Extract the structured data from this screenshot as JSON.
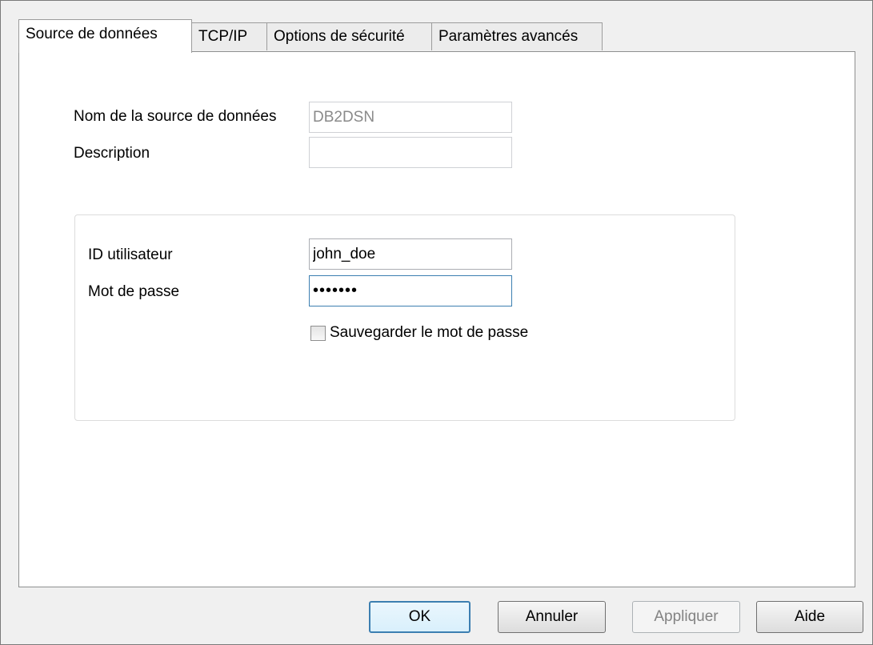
{
  "tabs": [
    {
      "label": "Source de données",
      "active": true
    },
    {
      "label": "TCP/IP",
      "active": false
    },
    {
      "label": "Options de sécurité",
      "active": false
    },
    {
      "label": "Paramètres avancés",
      "active": false
    }
  ],
  "form": {
    "dsn_label": "Nom de la source de données",
    "dsn_value": "DB2DSN",
    "description_label": "Description",
    "description_value": "",
    "userid_label": "ID utilisateur",
    "userid_value": "john_doe",
    "password_label": "Mot de passe",
    "password_value": "•••••••",
    "save_password_label": "Sauvegarder le mot de passe",
    "save_password_checked": false
  },
  "buttons": {
    "ok": "OK",
    "cancel": "Annuler",
    "apply": "Appliquer",
    "help": "Aide"
  },
  "colors": {
    "focus_border": "#3c7fb1",
    "disabled_text": "#8a8a8a"
  }
}
